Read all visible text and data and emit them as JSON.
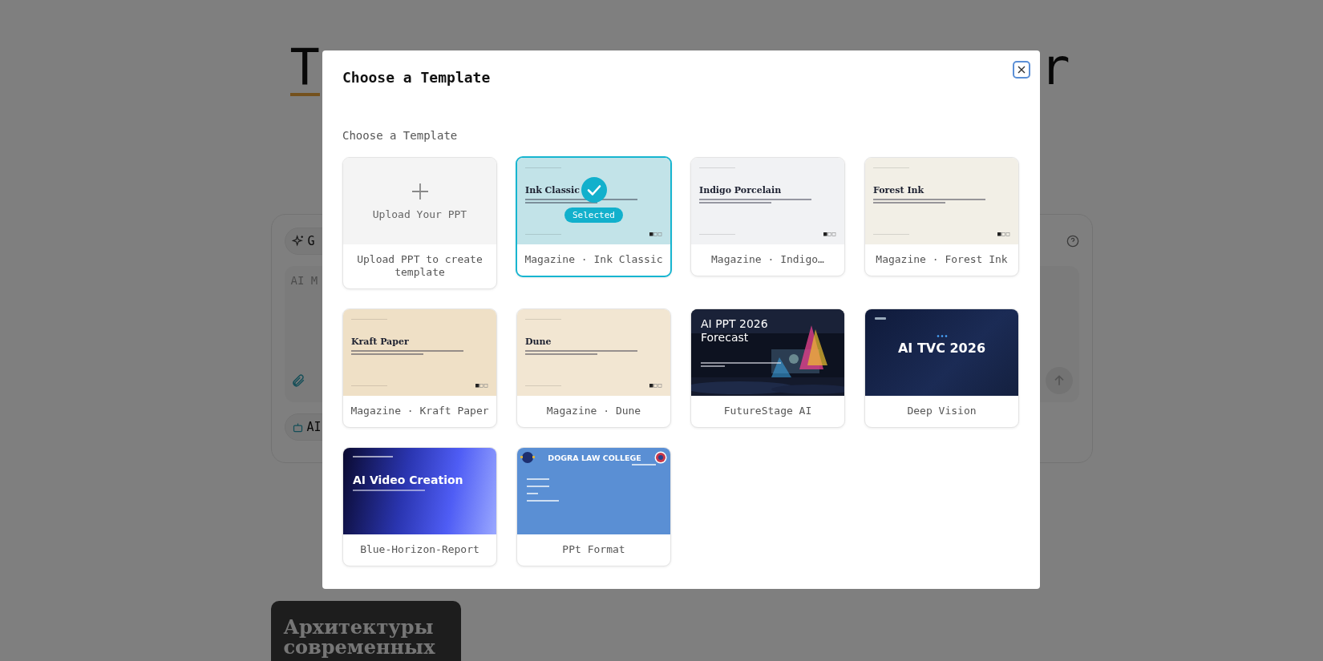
{
  "background": {
    "heading": [
      "T",
      "r"
    ],
    "mode_button": "G",
    "prompt_placeholder": "AI M",
    "agent_button": "AI",
    "deck_card": {
      "title": "Архитектуры современных"
    }
  },
  "dialog": {
    "title": "Choose a Template",
    "section_title": "Choose a Template",
    "selected_badge": "Selected",
    "templates": [
      {
        "kind": "upload",
        "selected": false,
        "thumb_label": "Upload Your PPT",
        "label": "Upload PPT to create template"
      },
      {
        "kind": "magazine",
        "selected": true,
        "color": "#c2e3e8",
        "title": "Ink Classic",
        "label": "Magazine · Ink Classic"
      },
      {
        "kind": "magazine",
        "selected": false,
        "color": "#f1f2f4",
        "title": "Indigo Porcelain",
        "label": "Magazine · Indigo…"
      },
      {
        "kind": "magazine",
        "selected": false,
        "color": "#f2efe6",
        "title": "Forest Ink",
        "label": "Magazine · Forest Ink"
      },
      {
        "kind": "magazine",
        "selected": false,
        "color": "#efe0c6",
        "title": "Kraft Paper",
        "label": "Magazine · Kraft Paper"
      },
      {
        "kind": "magazine",
        "selected": false,
        "color": "#f2e6d2",
        "title": "Dune",
        "label": "Magazine · Dune"
      },
      {
        "kind": "stage",
        "selected": false,
        "title": "AI PPT 2026 Forecast",
        "label": "FutureStage AI"
      },
      {
        "kind": "vision",
        "selected": false,
        "title": "AI TVC 2026",
        "label": "Deep Vision"
      },
      {
        "kind": "horizon",
        "selected": false,
        "title": "AI Video Creation",
        "label": "Blue-Horizon-Report"
      },
      {
        "kind": "college",
        "selected": false,
        "title": "DOGRA LAW COLLEGE",
        "label": "PPt Format"
      }
    ]
  }
}
